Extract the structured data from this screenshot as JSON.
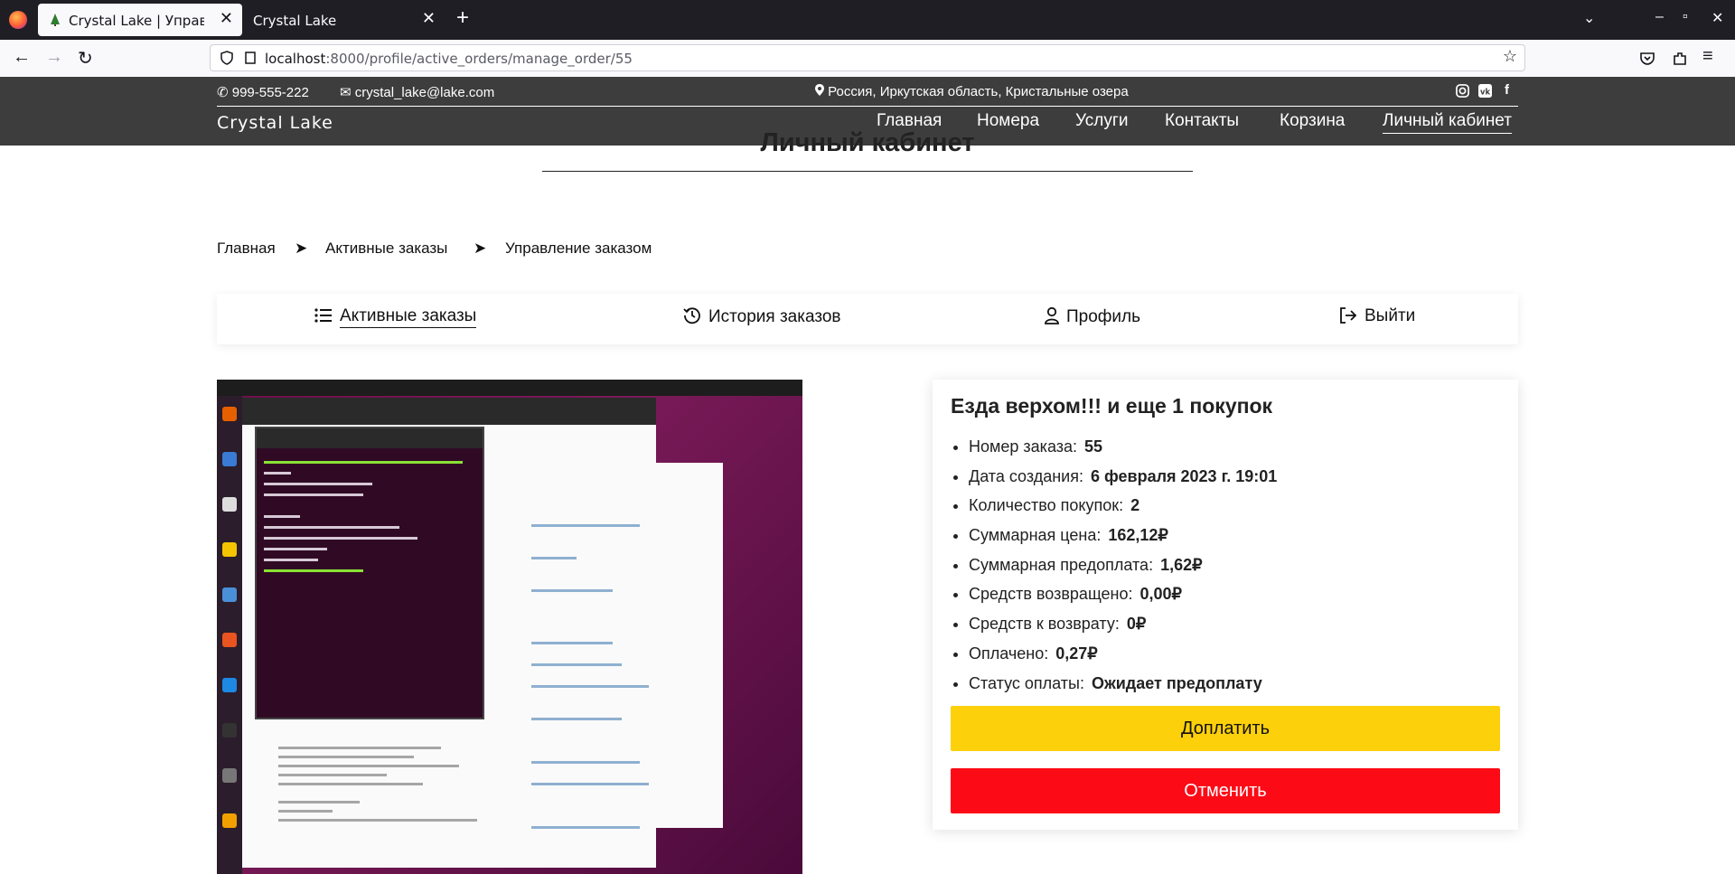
{
  "browser": {
    "tabs": [
      {
        "title": "Crystal Lake | Управление"
      },
      {
        "title": "Crystal Lake"
      }
    ],
    "url_host": "localhost",
    "url_path": ":8000/profile/active_orders/manage_order/55"
  },
  "header": {
    "phone": "999-555-222",
    "email": "crystal_lake@lake.com",
    "address": "Россия, Иркутская область, Кристальные озера",
    "brand": "Crystal Lake",
    "menu": [
      "Главная",
      "Номера",
      "Услуги",
      "Контакты",
      "Корзина",
      "Личный кабинет"
    ]
  },
  "page": {
    "title": "Личный кабинет",
    "breadcrumbs": [
      "Главная",
      "Активные заказы",
      "Управление заказом"
    ],
    "breadcrumb_sep": "➤",
    "profile_tabs": [
      "Активные заказы",
      "История заказов",
      "Профиль",
      "Выйти"
    ]
  },
  "order": {
    "title": "Езда верхом!!! и еще 1 покупок",
    "fields": [
      {
        "label": "Номер заказа:",
        "value": "55"
      },
      {
        "label": "Дата создания:",
        "value": "6 февраля 2023 г. 19:01"
      },
      {
        "label": "Количество покупок:",
        "value": "2"
      },
      {
        "label": "Суммарная цена:",
        "value": "162,12₽"
      },
      {
        "label": "Суммарная предоплата:",
        "value": "1,62₽"
      },
      {
        "label": "Средств возвращено:",
        "value": "0,00₽"
      },
      {
        "label": "Средств к возврату:",
        "value": "0₽"
      },
      {
        "label": "Оплачено:",
        "value": "0,27₽"
      },
      {
        "label": "Статус оплаты:",
        "value": "Ожидает предоплату"
      }
    ],
    "pay_button": "Доплатить",
    "cancel_button": "Отменить"
  },
  "colors": {
    "header_bg": "#3d3d3d",
    "pay": "#fcd00a",
    "cancel": "#fd0a17"
  }
}
